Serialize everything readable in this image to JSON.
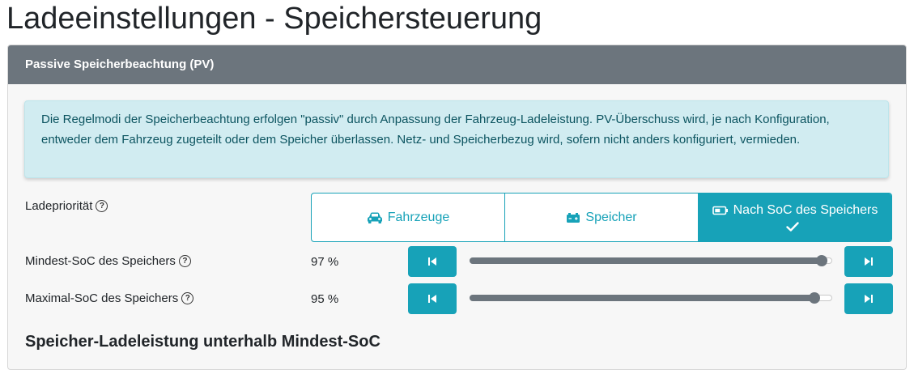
{
  "page": {
    "title": "Ladeeinstellungen - Speichersteuerung"
  },
  "card": {
    "header": "Passive Speicherbeachtung (PV)",
    "alert": "Die Regelmodi der Speicherbeachtung erfolgen \"passiv\" durch Anpassung der Fahrzeug-Ladeleistung. PV-Überschuss wird, je nach Konfiguration, entweder dem Fahrzeug zugeteilt oder dem Speicher überlassen. Netz- und Speicherbezug wird, sofern nicht anders konfiguriert, vermieden.",
    "priority": {
      "label": "Ladepriorität",
      "options": [
        {
          "label": "Fahrzeuge",
          "icon": "car-icon",
          "selected": false
        },
        {
          "label": "Speicher",
          "icon": "battery-icon",
          "selected": false
        },
        {
          "label": "Nach SoC des Speichers",
          "icon": "battery-half-icon",
          "selected": true
        }
      ]
    },
    "min_soc": {
      "label": "Mindest-SoC des Speichers",
      "value": "97 %",
      "level": 0.97
    },
    "max_soc": {
      "label": "Maximal-SoC des Speichers",
      "value": "95 %",
      "level": 0.95
    },
    "section_title": "Speicher-Ladeleistung unterhalb Mindest-SoC"
  },
  "colors": {
    "accent": "#17a2b8",
    "header": "#6c757d",
    "alert_bg": "#d1ecf1",
    "alert_text": "#0c5460"
  }
}
